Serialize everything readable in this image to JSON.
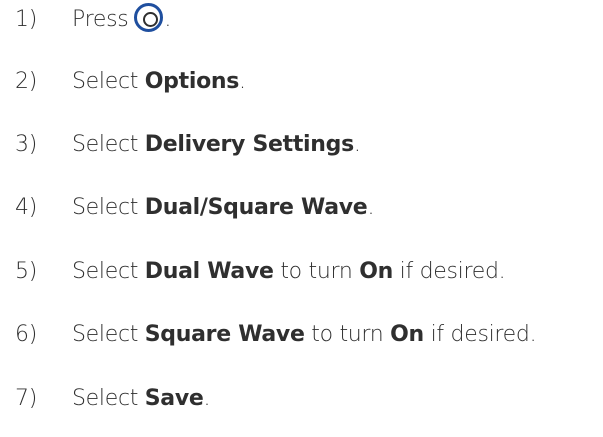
{
  "steps": [
    {
      "number": "1)",
      "parts": [
        {
          "text": "Press",
          "bold": false
        },
        {
          "icon": "select-button-icon"
        },
        {
          "text": ".",
          "bold": false
        }
      ]
    },
    {
      "number": "2)",
      "parts": [
        {
          "text": "Select ",
          "bold": false
        },
        {
          "text": "Options",
          "bold": true
        },
        {
          "text": ".",
          "bold": false
        }
      ]
    },
    {
      "number": "3)",
      "parts": [
        {
          "text": "Select ",
          "bold": false
        },
        {
          "text": "Delivery Settings",
          "bold": true
        },
        {
          "text": ".",
          "bold": false
        }
      ]
    },
    {
      "number": "4)",
      "parts": [
        {
          "text": "Select ",
          "bold": false
        },
        {
          "text": "Dual/Square Wave",
          "bold": true
        },
        {
          "text": ".",
          "bold": false
        }
      ]
    },
    {
      "number": "5)",
      "parts": [
        {
          "text": "Select ",
          "bold": false
        },
        {
          "text": "Dual Wave",
          "bold": true
        },
        {
          "text": " to turn ",
          "bold": false
        },
        {
          "text": "On",
          "bold": true
        },
        {
          "text": " if desired.",
          "bold": false
        }
      ]
    },
    {
      "number": "6)",
      "parts": [
        {
          "text": "Select ",
          "bold": false
        },
        {
          "text": "Square Wave",
          "bold": true
        },
        {
          "text": " to turn ",
          "bold": false
        },
        {
          "text": "On",
          "bold": true
        },
        {
          "text": " if desired.",
          "bold": false
        }
      ]
    },
    {
      "number": "7)",
      "parts": [
        {
          "text": "Select ",
          "bold": false
        },
        {
          "text": "Save",
          "bold": true
        },
        {
          "text": ".",
          "bold": false
        }
      ]
    }
  ],
  "colors": {
    "text": "#2f2f2f",
    "icon_ring": "#1f4f9f"
  }
}
